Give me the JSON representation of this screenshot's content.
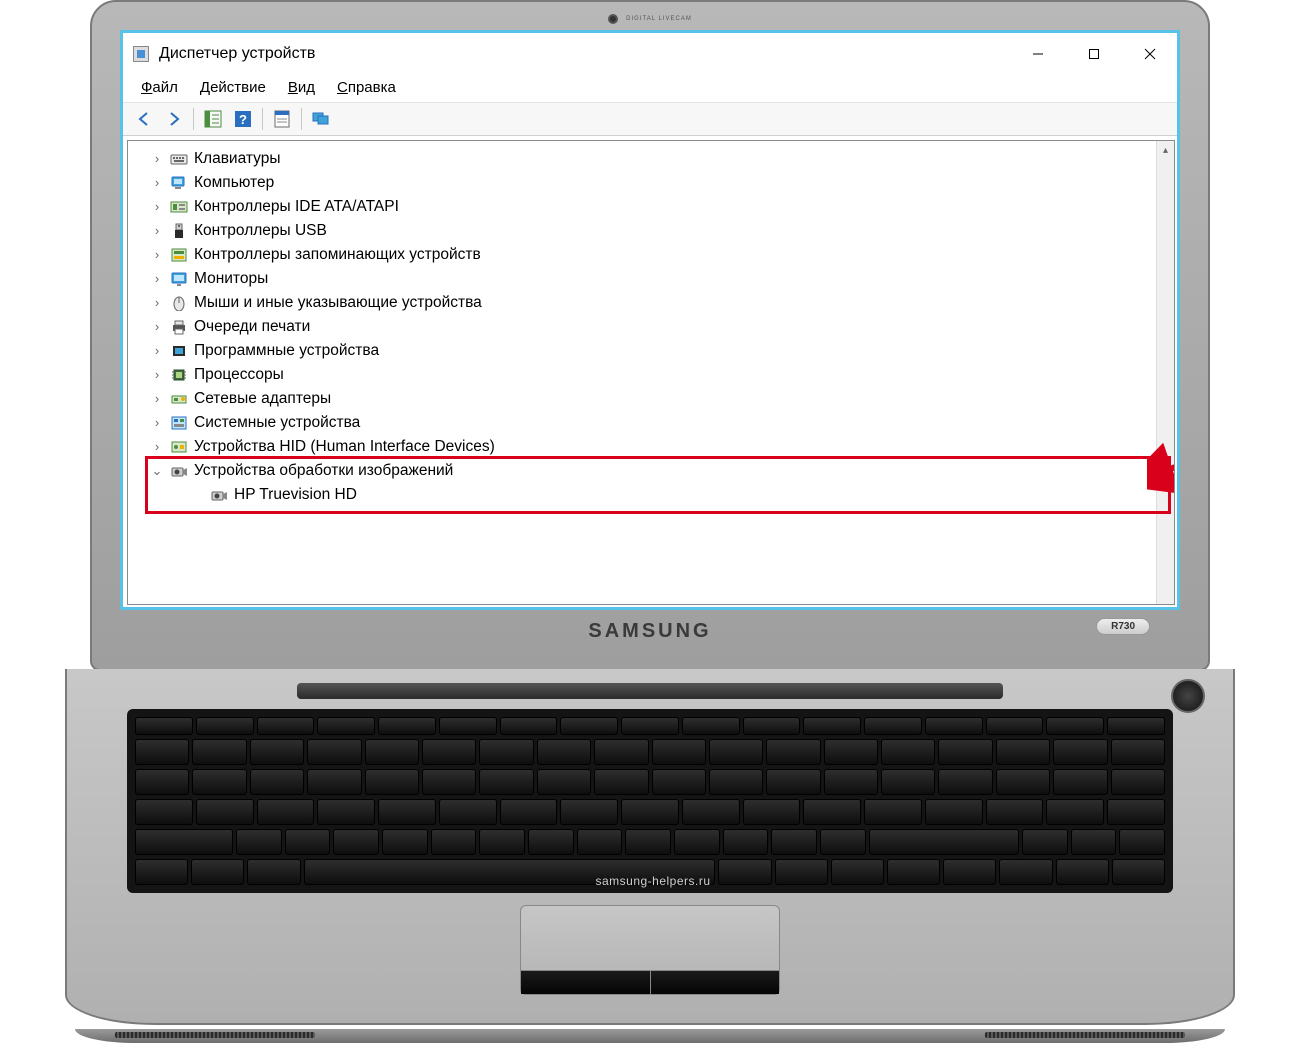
{
  "window": {
    "title": "Диспетчер устройств",
    "controls": {
      "minimize": "—",
      "maximize": "□",
      "close": "✕"
    }
  },
  "menu": {
    "file": {
      "label": "Файл",
      "hotidx": 0
    },
    "action": {
      "label": "Действие",
      "hotidx": 0
    },
    "view": {
      "label": "Вид",
      "hotidx": 0
    },
    "help": {
      "label": "Справка",
      "hotidx": 0
    }
  },
  "toolbar": {
    "back": "back-icon",
    "forward": "forward-icon",
    "tree": "tree-icon",
    "help": "help-icon",
    "props": "properties-icon",
    "monitors": "monitors-icon"
  },
  "tree": [
    {
      "expanded": false,
      "icon": "keyboard",
      "label": "Клавиатуры"
    },
    {
      "expanded": false,
      "icon": "computer",
      "label": "Компьютер"
    },
    {
      "expanded": false,
      "icon": "ide",
      "label": "Контроллеры IDE ATA/ATAPI"
    },
    {
      "expanded": false,
      "icon": "usb",
      "label": "Контроллеры USB"
    },
    {
      "expanded": false,
      "icon": "storage",
      "label": "Контроллеры запоминающих устройств"
    },
    {
      "expanded": false,
      "icon": "monitor",
      "label": "Мониторы"
    },
    {
      "expanded": false,
      "icon": "mouse",
      "label": "Мыши и иные указывающие устройства"
    },
    {
      "expanded": false,
      "icon": "printer",
      "label": "Очереди печати"
    },
    {
      "expanded": false,
      "icon": "firmware",
      "label": "Программные устройства"
    },
    {
      "expanded": false,
      "icon": "cpu",
      "label": "Процессоры"
    },
    {
      "expanded": false,
      "icon": "network",
      "label": "Сетевые адаптеры"
    },
    {
      "expanded": false,
      "icon": "system",
      "label": "Системные устройства"
    },
    {
      "expanded": false,
      "icon": "hid",
      "label": "Устройства HID (Human Interface Devices)"
    },
    {
      "expanded": true,
      "icon": "camera",
      "label": "Устройства обработки изображений",
      "children": [
        {
          "icon": "camera",
          "label": "HP Truevision HD"
        }
      ]
    }
  ],
  "laptop": {
    "brand": "SAMSUNG",
    "model": "R730",
    "webcam": "DIGITAL LIVECAM"
  },
  "watermark": "samsung-helpers.ru"
}
